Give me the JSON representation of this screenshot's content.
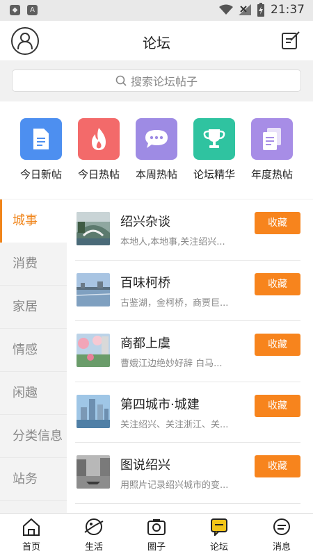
{
  "status_bar": {
    "time": "21:37"
  },
  "header": {
    "title": "论坛"
  },
  "search": {
    "placeholder": "搜索论坛帖子"
  },
  "quick_links": [
    {
      "label": "今日新帖",
      "icon": "document-icon",
      "color": "#4d8ff0"
    },
    {
      "label": "今日热帖",
      "icon": "flame-icon",
      "color": "#f36a6a"
    },
    {
      "label": "本周热帖",
      "icon": "chat-bubble-icon",
      "color": "#9e8be4"
    },
    {
      "label": "论坛精华",
      "icon": "trophy-icon",
      "color": "#2fc3a0"
    },
    {
      "label": "年度热帖",
      "icon": "files-icon",
      "color": "#a78de6"
    }
  ],
  "categories": [
    {
      "label": "城事",
      "active": true
    },
    {
      "label": "消费"
    },
    {
      "label": "家居"
    },
    {
      "label": "情感"
    },
    {
      "label": "闲趣"
    },
    {
      "label": "分类信息"
    },
    {
      "label": "站务"
    }
  ],
  "forums": [
    {
      "title": "绍兴杂谈",
      "desc": "本地人,本地事,关注绍兴...",
      "button": "收藏"
    },
    {
      "title": "百味柯桥",
      "desc": "古鉴湖，金柯桥，商贾巨...",
      "button": "收藏"
    },
    {
      "title": "商都上虞",
      "desc": "曹娥江边绝妙好辞 白马...",
      "button": "收藏"
    },
    {
      "title": "第四城市·城建",
      "desc": "关注绍兴、关注浙江、关...",
      "button": "收藏"
    },
    {
      "title": "图说绍兴",
      "desc": "用照片记录绍兴城市的变...",
      "button": "收藏"
    }
  ],
  "tabbar": [
    {
      "label": "首页",
      "icon": "home-icon"
    },
    {
      "label": "生活",
      "icon": "planet-icon"
    },
    {
      "label": "圈子",
      "icon": "camera-icon"
    },
    {
      "label": "论坛",
      "icon": "forum-icon",
      "active": true
    },
    {
      "label": "消息",
      "icon": "message-icon"
    }
  ]
}
